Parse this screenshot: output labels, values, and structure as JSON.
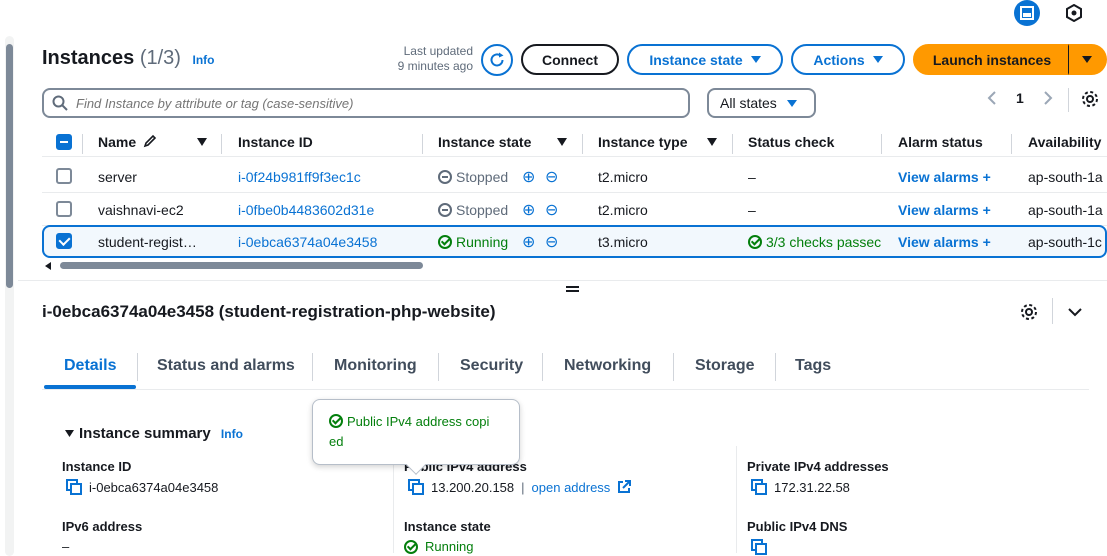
{
  "header": {
    "title": "Instances",
    "count": "(1/3)",
    "info": "Info",
    "last_updated_label": "Last updated",
    "last_updated_value": "9 minutes ago",
    "connect_label": "Connect",
    "instance_state_label": "Instance state",
    "actions_label": "Actions",
    "launch_label": "Launch instances"
  },
  "filter": {
    "search_placeholder": "Find Instance by attribute or tag (case-sensitive)",
    "state_select": "All states",
    "page": "1"
  },
  "table": {
    "columns": [
      "Name",
      "Instance ID",
      "Instance state",
      "Instance type",
      "Status check",
      "Alarm status",
      "Availability"
    ],
    "rows": [
      {
        "name": "server",
        "id": "i-0f24b981ff9f3ec1c",
        "state": "Stopped",
        "type": "t2.micro",
        "status": "–",
        "alarm": "View alarms",
        "az": "ap-south-1a",
        "selected": false
      },
      {
        "name": "vaishnavi-ec2",
        "id": "i-0fbe0b4483602d31e",
        "state": "Stopped",
        "type": "t2.micro",
        "status": "–",
        "alarm": "View alarms",
        "az": "ap-south-1a",
        "selected": false
      },
      {
        "name": "student-regist…",
        "id": "i-0ebca6374a04e3458",
        "state": "Running",
        "type": "t3.micro",
        "status": "3/3 checks passec",
        "alarm": "View alarms",
        "az": "ap-south-1c",
        "selected": true
      }
    ]
  },
  "details": {
    "title": "i-0ebca6374a04e3458 (student-registration-php-website)",
    "tabs": [
      "Details",
      "Status and alarms",
      "Monitoring",
      "Security",
      "Networking",
      "Storage",
      "Tags"
    ],
    "active_tab": "Details",
    "summary_title": "Instance summary",
    "summary_info": "Info",
    "instance_id_label": "Instance ID",
    "instance_id_value": "i-0ebca6374a04e3458",
    "public_ipv4_label": "Public IPv4 address",
    "public_ipv4_value": "13.200.20.158",
    "open_address": "open address",
    "private_ipv4_label": "Private IPv4 addresses",
    "private_ipv4_value": "172.31.22.58",
    "ipv6_label": "IPv6 address",
    "ipv6_value": "–",
    "instance_state_label": "Instance state",
    "instance_state_value": "Running",
    "public_dns_label": "Public IPv4 DNS"
  },
  "toast": {
    "message_line1": "Public IPv4 address copi",
    "message_line2": "ed"
  },
  "colors": {
    "accent": "#0972d3",
    "primary_button": "#ff9900",
    "success": "#037f0c"
  }
}
